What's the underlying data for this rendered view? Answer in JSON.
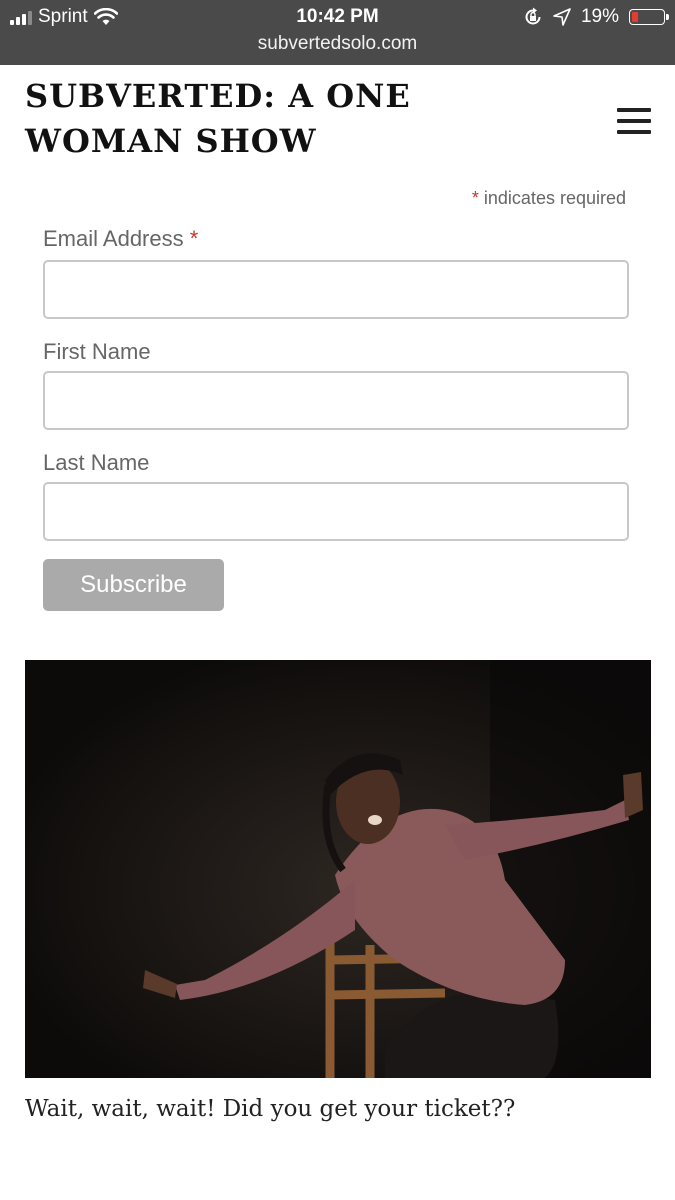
{
  "status_bar": {
    "carrier": "Sprint",
    "time": "10:42 PM",
    "battery_percent": "19%",
    "battery_level": 0.19,
    "url": "subvertedsolo.com"
  },
  "header": {
    "site_title": "SUBVERTED: A ONE WOMAN SHOW"
  },
  "form": {
    "required_asterisk": "*",
    "required_note": "indicates required",
    "fields": [
      {
        "label": "Email Address",
        "required": true,
        "value": ""
      },
      {
        "label": "First Name",
        "required": false,
        "value": ""
      },
      {
        "label": "Last Name",
        "required": false,
        "value": ""
      }
    ],
    "subscribe_label": "Subscribe"
  },
  "post": {
    "caption": "Wait, wait, wait! Did you get your ticket??"
  },
  "colors": {
    "status_bar_bg": "#4a4a4a",
    "required_red": "#c0392b",
    "button_gray": "#aaaaaa",
    "battery_red": "#e53b30"
  }
}
